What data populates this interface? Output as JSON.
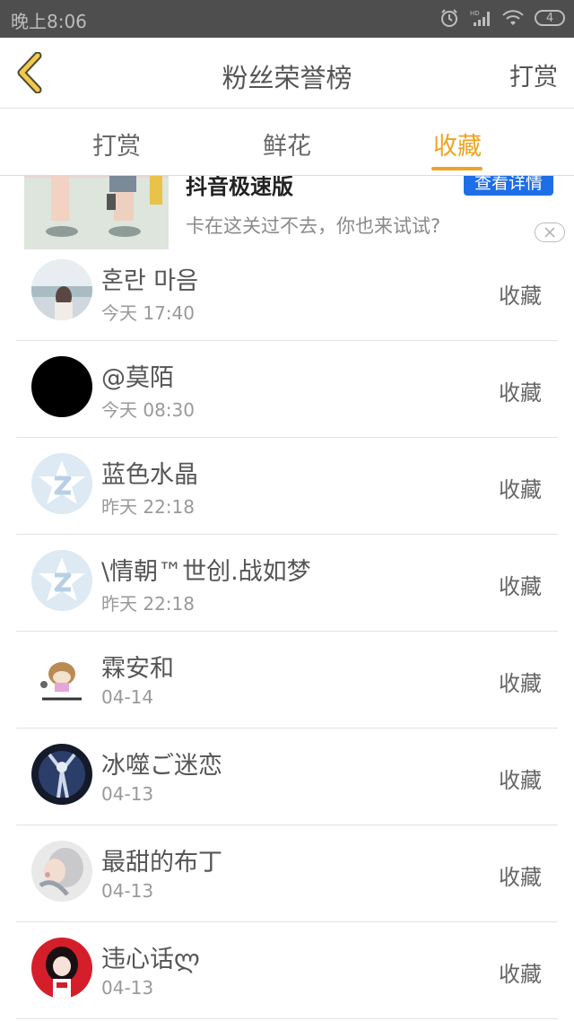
{
  "status_bar": {
    "time": "晚上8:06",
    "battery": "4"
  },
  "header": {
    "title": "粉丝荣誉榜",
    "action": "打赏"
  },
  "tabs": [
    {
      "label": "打赏"
    },
    {
      "label": "鲜花"
    },
    {
      "label": "收藏"
    }
  ],
  "active_tab": 2,
  "ad": {
    "title": "抖音极速版",
    "button": "查看详情",
    "description": "卡在这关过不去，你也来试试?"
  },
  "list": [
    {
      "name": "혼란 마음",
      "time": "今天 17:40",
      "action": "收藏",
      "avatar": "photo-avatar"
    },
    {
      "name": "@莫陌",
      "time": "今天 08:30",
      "action": "收藏",
      "avatar": "black-avatar"
    },
    {
      "name": "蓝色水晶",
      "time": "昨天 22:18",
      "action": "收藏",
      "avatar": "default-avatar"
    },
    {
      "name": "\\情朝™世创.战如梦",
      "time": "昨天 22:18",
      "action": "收藏",
      "avatar": "default-avatar"
    },
    {
      "name": "霖安和",
      "time": "04-14",
      "action": "收藏",
      "avatar": "cartoon-avatar"
    },
    {
      "name": "冰噬ご迷恋",
      "time": "04-13",
      "action": "收藏",
      "avatar": "dark-avatar"
    },
    {
      "name": "最甜的布丁",
      "time": "04-13",
      "action": "收藏",
      "avatar": "anime-avatar"
    },
    {
      "name": "违心话ლ",
      "time": "04-13",
      "action": "收藏",
      "avatar": "red-avatar"
    }
  ],
  "colors": {
    "accent": "#f0a321",
    "status_bar": "#4e4e4e",
    "ad_button": "#1e6fe6"
  }
}
